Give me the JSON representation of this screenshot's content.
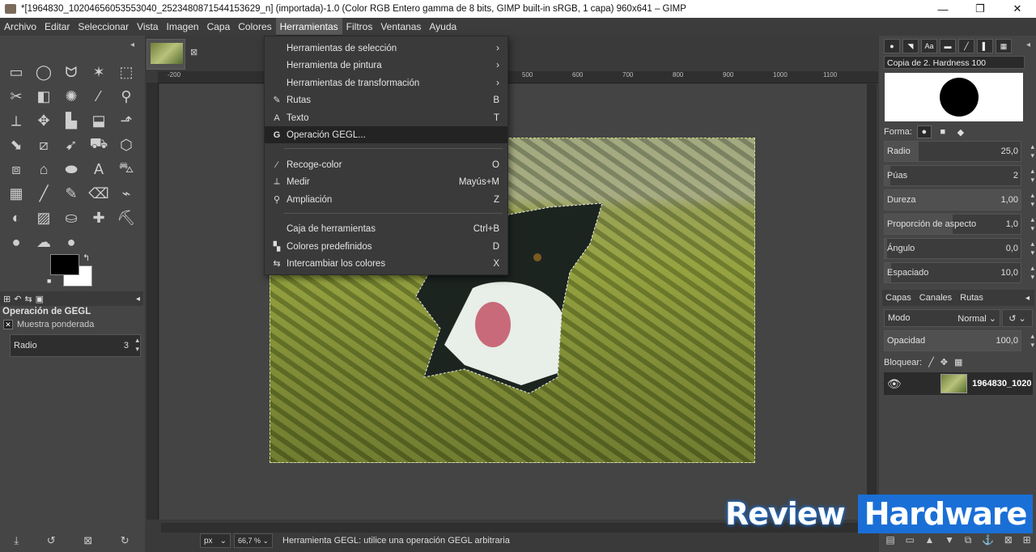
{
  "window": {
    "title": "*[1964830_10204656053553040_2523480871544153629_n] (importada)-1.0 (Color RGB Entero gamma de 8 bits, GIMP built-in sRGB, 1 capa) 960x641 – GIMP",
    "minimize": "—",
    "maximize": "❐",
    "close": "✕"
  },
  "menubar": {
    "items": [
      "Archivo",
      "Editar",
      "Seleccionar",
      "Vista",
      "Imagen",
      "Capa",
      "Colores",
      "Herramientas",
      "Filtros",
      "Ventanas",
      "Ayuda"
    ],
    "active": "Herramientas"
  },
  "tools_menu": {
    "items": [
      {
        "label": "Herramientas de selección",
        "shortcut": "›",
        "icon": ""
      },
      {
        "label": "Herramienta de pintura",
        "shortcut": "›",
        "icon": ""
      },
      {
        "label": "Herramientas de transformación",
        "shortcut": "›",
        "icon": ""
      },
      {
        "label": "Rutas",
        "shortcut": "B",
        "icon": "✎"
      },
      {
        "label": "Texto",
        "shortcut": "T",
        "icon": "A"
      },
      {
        "label": "Operación GEGL...",
        "shortcut": "",
        "icon": "G"
      },
      {
        "label": "Recoge-color",
        "shortcut": "O",
        "icon": "⁄"
      },
      {
        "label": "Medir",
        "shortcut": "Mayús+M",
        "icon": "⟂"
      },
      {
        "label": "Ampliación",
        "shortcut": "Z",
        "icon": "⚲"
      },
      {
        "label": "Caja de herramientas",
        "shortcut": "Ctrl+B",
        "icon": ""
      },
      {
        "label": "Colores predefinidos",
        "shortcut": "D",
        "icon": "▚"
      },
      {
        "label": "Intercambiar los colores",
        "shortcut": "X",
        "icon": "⇆"
      }
    ]
  },
  "toolbox": {
    "tool_glyphs": [
      "▭",
      "◯",
      "ᗢ",
      "✶",
      "⬚",
      "✂",
      "◧",
      "✺",
      "⁄",
      "⚲",
      "⟂",
      "✥",
      "▙",
      "⬓",
      "⬏",
      "⬊",
      "⧄",
      "➹",
      "⛟",
      "⬡",
      "⧈",
      "⌂",
      "⬬",
      "A",
      "⛍",
      "▦",
      "╱",
      "✎",
      "⌫",
      "⌁",
      "◐",
      "▨",
      "⛀",
      "✚",
      "⛏",
      "●",
      "☁",
      "●"
    ],
    "fg_color": "#000000",
    "bg_color": "#ffffff",
    "swap": "↰",
    "reset": "■",
    "options_tabs": [
      "⊞",
      "↶",
      "⇆",
      "▣"
    ],
    "options_title": "Operación de GEGL",
    "check_label": "Muestra ponderada",
    "check_mark": "✕",
    "radio_label": "Radio",
    "radio_value": "3",
    "bottom_icons": [
      "⤓",
      "↺",
      "⊠",
      "↻"
    ]
  },
  "canvas": {
    "ruler_labels": [
      "-200",
      "500",
      "600",
      "700",
      "800",
      "900",
      "1000",
      "1100"
    ],
    "tab_close": "⊠",
    "unit": "px",
    "zoom": "66,7 %",
    "status": "Herramienta GEGL: utilice una operación GEGL arbitraria"
  },
  "brushes": {
    "tab_icons": [
      "●",
      "◥",
      "Aa",
      "▬",
      "╱",
      "▌",
      "▦"
    ],
    "name": "Copia de 2. Hardness 100",
    "forma_label": "Forma:",
    "shapes": [
      "●",
      "■",
      "◆"
    ],
    "sliders": [
      {
        "label": "Radio",
        "value": "25,0",
        "fill": 0.25
      },
      {
        "label": "Púas",
        "value": "2",
        "fill": 0.04
      },
      {
        "label": "Dureza",
        "value": "1,00",
        "fill": 1.0
      },
      {
        "label": "Proporción de aspecto",
        "value": "1,0",
        "fill": 0.5
      },
      {
        "label": "Ángulo",
        "value": "0,0",
        "fill": 0.02
      },
      {
        "label": "Espaciado",
        "value": "10,0",
        "fill": 0.05
      }
    ]
  },
  "layers": {
    "tabs": [
      "Capas",
      "Canales",
      "Rutas"
    ],
    "mode_label": "Modo",
    "mode_value": "Normal",
    "opacity_label": "Opacidad",
    "opacity_value": "100,0",
    "lock_label": "Bloquear:",
    "lock_icons": [
      "╱",
      "✥",
      "▦"
    ],
    "layer_name": "1964830_1020",
    "eye": "👁",
    "bottom_icons": [
      "▤",
      "▭",
      "▲",
      "▼",
      "⧉",
      "⚓",
      "⊠",
      "⊞"
    ]
  },
  "watermark": {
    "word1": "Review",
    "word2": "Hardware"
  },
  "colors": {
    "accent": "#1a6fd6",
    "menu_highlight": "#232323"
  }
}
